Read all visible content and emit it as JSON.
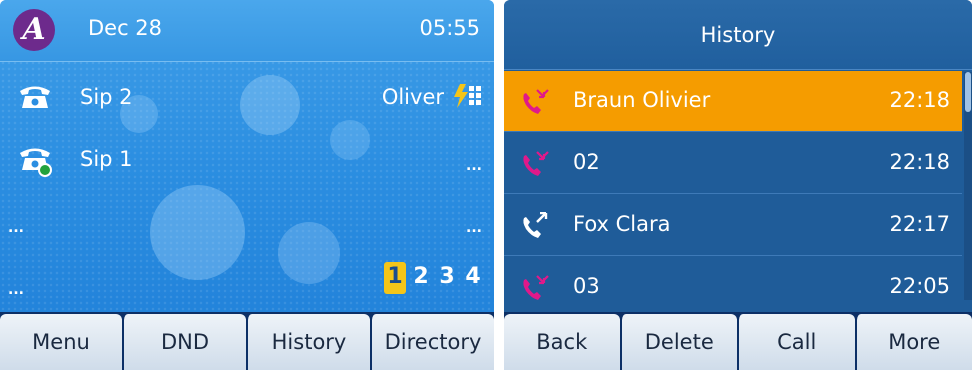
{
  "idle_screen": {
    "header": {
      "date": "Dec 28",
      "time": "05:55",
      "logo_icon": "alcatel-lucent-logo"
    },
    "lines": [
      {
        "label": "Sip 2",
        "icon": "desk-phone-icon",
        "registered": false
      },
      {
        "label": "Sip 1",
        "icon": "desk-phone-icon",
        "registered": true
      }
    ],
    "account_name": "Oliver",
    "network_icon": "lightning-grid-icon",
    "ellipsis": "...",
    "pages": [
      "1",
      "2",
      "3",
      "4"
    ],
    "active_page": "1",
    "softkeys": [
      "Menu",
      "DND",
      "History",
      "Directory"
    ]
  },
  "history_screen": {
    "title": "History",
    "entries": [
      {
        "name": "Braun Olivier",
        "time": "22:18",
        "type": "missed",
        "selected": true
      },
      {
        "name": "02",
        "time": "22:18",
        "type": "missed",
        "selected": false
      },
      {
        "name": "Fox Clara",
        "time": "22:17",
        "type": "outgoing",
        "selected": false
      },
      {
        "name": "03",
        "time": "22:05",
        "type": "missed",
        "selected": false
      }
    ],
    "softkeys": [
      "Back",
      "Delete",
      "Call",
      "More"
    ]
  },
  "colors": {
    "idle_bg": "#2b8ee1",
    "history_bg": "#1f5c99",
    "selected_row": "#f59c00",
    "missed_call": "#e0198a",
    "active_page": "#f5c518",
    "softkey_bar": "#0c2f66"
  }
}
